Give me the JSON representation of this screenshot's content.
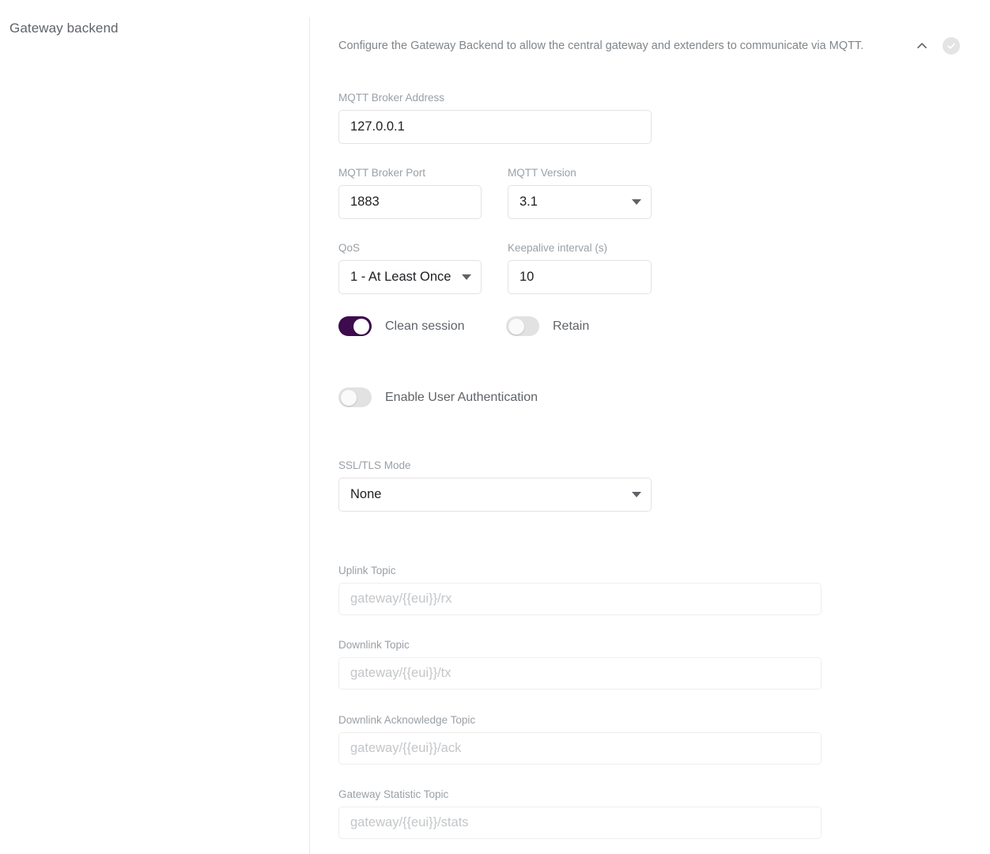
{
  "sidebar": {
    "title": "Gateway backend"
  },
  "header": {
    "description": "Configure the Gateway Backend to allow the central gateway and extenders to communicate via MQTT.",
    "collapse_icon": "chevron-up-icon",
    "status_icon": "check-circle-icon"
  },
  "colors": {
    "toggle_on": "#3d0b4e",
    "toggle_off": "#e2e2e2",
    "label_text": "#9aa0a6",
    "value_text": "#202124",
    "placeholder_text": "#c3c6c9",
    "border": "#e3e3e3",
    "status_badge": "#e4e4e4"
  },
  "form": {
    "broker_address": {
      "label": "MQTT Broker Address",
      "value": "127.0.0.1"
    },
    "broker_port": {
      "label": "MQTT Broker Port",
      "value": "1883"
    },
    "mqtt_version": {
      "label": "MQTT Version",
      "value": "3.1",
      "icon": "chevron-down-icon"
    },
    "qos": {
      "label": "QoS",
      "value": "1 - At Least Once",
      "icon": "chevron-down-icon"
    },
    "keepalive": {
      "label": "Keepalive interval (s)",
      "value": "10"
    },
    "clean_session": {
      "label": "Clean session",
      "state": "on"
    },
    "retain": {
      "label": "Retain",
      "state": "off"
    },
    "user_auth": {
      "label": "Enable User Authentication",
      "state": "off"
    },
    "ssl_tls_mode": {
      "label": "SSL/TLS Mode",
      "value": "None",
      "icon": "chevron-down-icon"
    },
    "uplink_topic": {
      "label": "Uplink Topic",
      "placeholder": "gateway/{{eui}}/rx",
      "value": ""
    },
    "downlink_topic": {
      "label": "Downlink Topic",
      "placeholder": "gateway/{{eui}}/tx",
      "value": ""
    },
    "downlink_ack_topic": {
      "label": "Downlink Acknowledge Topic",
      "placeholder": "gateway/{{eui}}/ack",
      "value": ""
    },
    "gateway_stat_topic": {
      "label": "Gateway Statistic Topic",
      "placeholder": "gateway/{{eui}}/stats",
      "value": ""
    }
  }
}
